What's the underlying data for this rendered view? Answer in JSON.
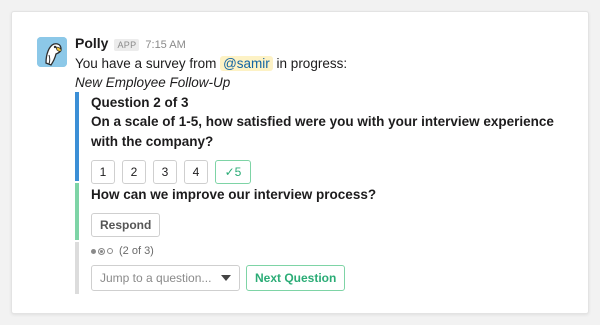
{
  "message": {
    "sender": "Polly",
    "badge": "APP",
    "time": "7:15 AM",
    "text_before": "You have a survey from ",
    "mention": "@samir",
    "text_after": " in progress:",
    "survey_name": "New Employee Follow-Up",
    "avatar_icon": "parrot-icon"
  },
  "question1": {
    "title": "Question 2 of 3",
    "text": "On a scale of 1-5, how satisfied were you with your interview experience with the company?",
    "options": [
      "1",
      "2",
      "3",
      "4",
      "✓5"
    ],
    "selected_index": 4
  },
  "question2": {
    "text": "How can we improve our interview process?",
    "respond_label": "Respond"
  },
  "nav": {
    "progress": "(2 of 3)",
    "jump_placeholder": "Jump to a question...",
    "next_label": "Next Question"
  },
  "colors": {
    "section1": "#3b8fd6",
    "section2": "#7ed4a6",
    "section3": "#dcdcdc",
    "accent_green": "#2bac76",
    "mention": "#1264a3"
  }
}
